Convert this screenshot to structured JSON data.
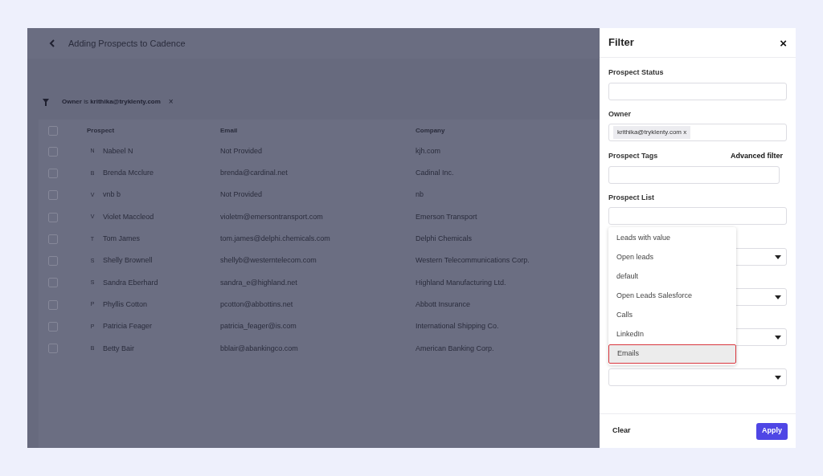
{
  "header": {
    "title": "Adding Prospects to Cadence"
  },
  "active_filter": {
    "field": "Owner",
    "operator": "is",
    "value": "krithika@tryklenty.com",
    "remove": "×"
  },
  "table": {
    "select_all_checked": false,
    "columns": [
      "Prospect",
      "Email",
      "Company"
    ],
    "rows": [
      {
        "initial": "N",
        "name": "Nabeel N",
        "email": "Not Provided",
        "company": "kjh.com",
        "checked": false
      },
      {
        "initial": "B",
        "name": "Brenda Mcclure",
        "email": "brenda@cardinal.net",
        "company": "Cadinal Inc.",
        "checked": false
      },
      {
        "initial": "V",
        "name": "vnb b",
        "email": "Not Provided",
        "company": "nb",
        "checked": false
      },
      {
        "initial": "V",
        "name": "Violet Maccleod",
        "email": "violetm@emersontransport.com",
        "company": "Emerson Transport",
        "checked": false
      },
      {
        "initial": "T",
        "name": "Tom James",
        "email": "tom.james@delphi.chemicals.com",
        "company": "Delphi Chemicals",
        "checked": false
      },
      {
        "initial": "S",
        "name": "Shelly Brownell",
        "email": "shellyb@westerntelecom.com",
        "company": "Western Telecommunications Corp.",
        "checked": false
      },
      {
        "initial": "S",
        "name": "Sandra Eberhard",
        "email": "sandra_e@highland.net",
        "company": "Highland Manufacturing Ltd.",
        "checked": false
      },
      {
        "initial": "P",
        "name": "Phyllis Cotton",
        "email": "pcotton@abbottins.net",
        "company": "Abbott Insurance",
        "checked": false
      },
      {
        "initial": "P",
        "name": "Patricia Feager",
        "email": "patricia_feager@is.com",
        "company": "International Shipping Co.",
        "checked": false
      },
      {
        "initial": "B",
        "name": "Betty Bair",
        "email": "bblair@abankingco.com",
        "company": "American Banking Corp.",
        "checked": false
      }
    ]
  },
  "filter_panel": {
    "title": "Filter",
    "close": "×",
    "prospect_status": {
      "label": "Prospect Status"
    },
    "owner": {
      "label": "Owner",
      "tag": "krithika@tryklenty.com x"
    },
    "prospect_tags": {
      "label": "Prospect Tags",
      "advanced_link": "Advanced filter"
    },
    "prospect_list": {
      "label": "Prospect List"
    },
    "dropdown_options": [
      {
        "label": "Leads with value",
        "selected": false
      },
      {
        "label": "Open leads",
        "selected": false
      },
      {
        "label": "default",
        "selected": false
      },
      {
        "label": "Open Leads Salesforce",
        "selected": false
      },
      {
        "label": "Calls",
        "selected": false
      },
      {
        "label": "LinkedIn",
        "selected": false
      },
      {
        "label": "Emails",
        "selected": true
      }
    ],
    "clear": "Clear",
    "apply": "Apply"
  }
}
